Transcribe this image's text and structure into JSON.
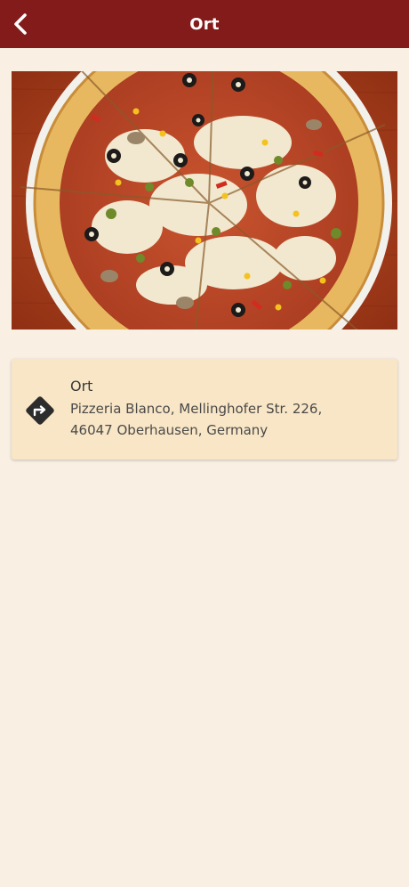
{
  "header": {
    "title": "Ort",
    "back_icon": "chevron-left-icon"
  },
  "hero": {
    "alt": "Pizza"
  },
  "location": {
    "label": "Ort",
    "address_line1": "Pizzeria Blanco, Mellinghofer Str. 226,",
    "address_line2": "46047 Oberhausen, Germany",
    "icon": "directions-icon"
  },
  "colors": {
    "app_bar": "#841b1b",
    "background": "#f9efe3",
    "card": "#f8e6c6",
    "text": "#3a3a3a"
  }
}
